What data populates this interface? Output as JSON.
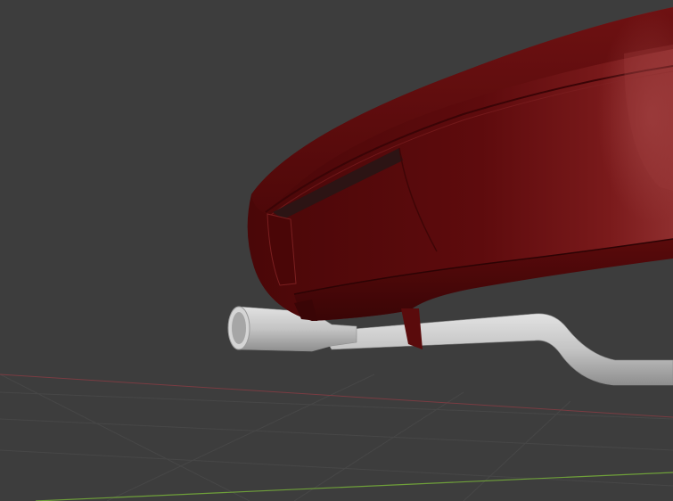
{
  "viewport": {
    "background_color": "#3d3d3d",
    "grid_color": "#4a4a4a",
    "x_axis_color": "#8a3f45",
    "y_axis_color": "#6fa03a"
  },
  "scene": {
    "body_color": "#5e0b0d",
    "body_highlight": "#8f2b2c",
    "body_shadow": "#2e0506",
    "vent_color": "#2c1414",
    "pipe_color": "#c6c6c6",
    "pipe_shadow": "#8e8e8e",
    "pipe_inner": "#9a9a9a"
  }
}
